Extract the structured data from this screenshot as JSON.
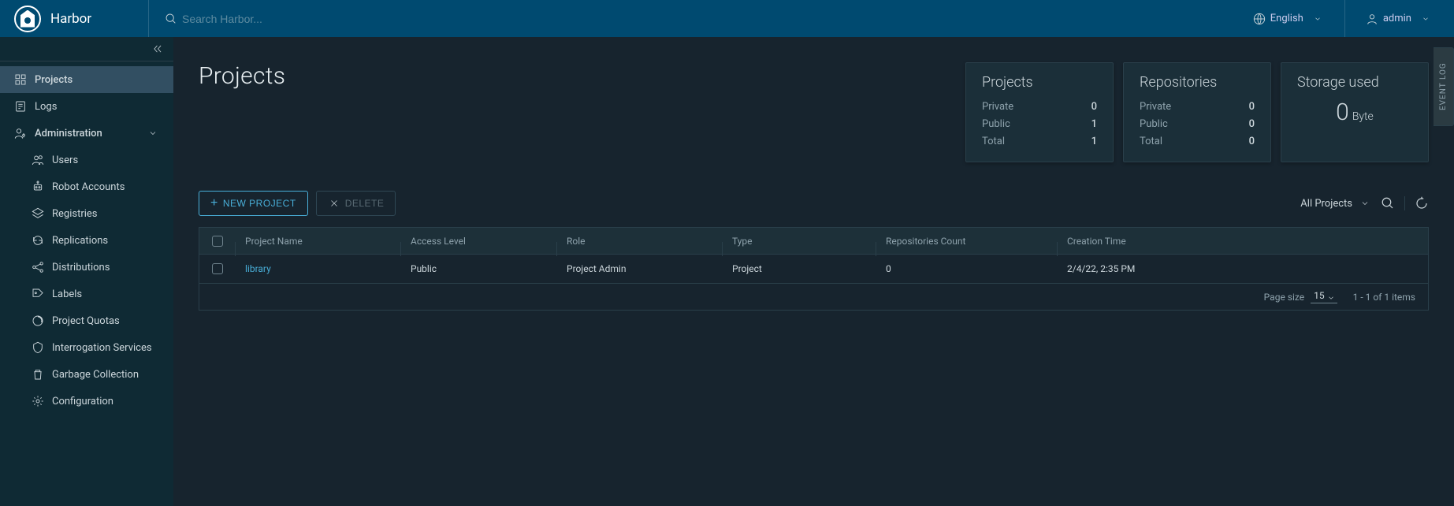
{
  "header": {
    "app_name": "Harbor",
    "search_placeholder": "Search Harbor...",
    "language_label": "English",
    "user_label": "admin"
  },
  "sidebar": {
    "projects": "Projects",
    "logs": "Logs",
    "administration": "Administration",
    "admin_items": [
      "Users",
      "Robot Accounts",
      "Registries",
      "Replications",
      "Distributions",
      "Labels",
      "Project Quotas",
      "Interrogation Services",
      "Garbage Collection",
      "Configuration"
    ]
  },
  "page": {
    "title": "Projects",
    "stats": {
      "projects": {
        "title": "Projects",
        "private_label": "Private",
        "private_val": "0",
        "public_label": "Public",
        "public_val": "1",
        "total_label": "Total",
        "total_val": "1"
      },
      "repositories": {
        "title": "Repositories",
        "private_label": "Private",
        "private_val": "0",
        "public_label": "Public",
        "public_val": "0",
        "total_label": "Total",
        "total_val": "0"
      },
      "storage": {
        "title": "Storage used",
        "value": "0",
        "unit": "Byte"
      }
    },
    "toolbar": {
      "new_project": "New Project",
      "delete": "Delete",
      "filter": "All Projects"
    },
    "table": {
      "columns": {
        "name": "Project Name",
        "access": "Access Level",
        "role": "Role",
        "type": "Type",
        "repos": "Repositories Count",
        "ctime": "Creation Time"
      },
      "rows": [
        {
          "name": "library",
          "access": "Public",
          "role": "Project Admin",
          "type": "Project",
          "repos": "0",
          "ctime": "2/4/22, 2:35 PM"
        }
      ],
      "footer": {
        "page_size_label": "Page size",
        "page_size_value": "15",
        "range": "1 - 1 of 1 items"
      }
    }
  },
  "event_log_label": "EVENT LOG"
}
